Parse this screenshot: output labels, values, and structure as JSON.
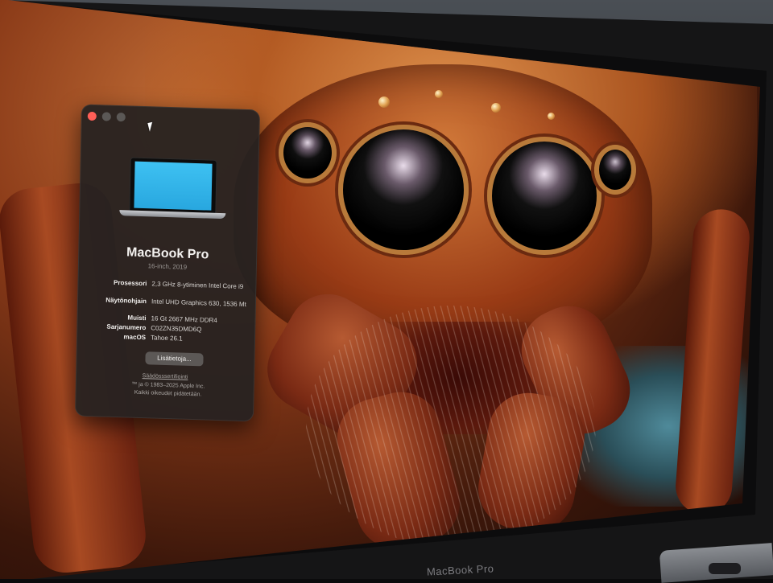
{
  "window": {
    "title_bar": {
      "close": "close",
      "minimize": "minimize",
      "zoom": "zoom"
    },
    "model_name": "MacBook Pro",
    "model_subtitle": "16-inch, 2019",
    "specs": [
      {
        "label": "Prosessori",
        "value": "2,3 GHz 8-ytiminen Intel Core i9"
      },
      {
        "label": "Näytönohjain",
        "value": "Intel UHD Graphics 630, 1536 Mt"
      },
      {
        "label": "Muisti",
        "value": "16 Gt 2667 MHz DDR4"
      },
      {
        "label": "Sarjanumero",
        "value": "C02ZN35DMD6Q"
      },
      {
        "label": "macOS",
        "value": "Tahoe 26.1"
      }
    ],
    "more_info_button": "Lisätietoja...",
    "regulatory_link": "Säädösssertifiointi",
    "copyright_line1": "™ ja © 1983–2025 Apple Inc.",
    "copyright_line2": "Kaikki oikeudet pidätetään."
  },
  "device": {
    "bezel_label": "MacBook Pro"
  },
  "icons": {
    "cursor": "arrow-cursor-icon",
    "laptop": "macbook-illustration-icon"
  },
  "colors": {
    "window_bg": "#262221",
    "close_button": "#ff5f57",
    "laptop_display": "#3ec1f2"
  }
}
